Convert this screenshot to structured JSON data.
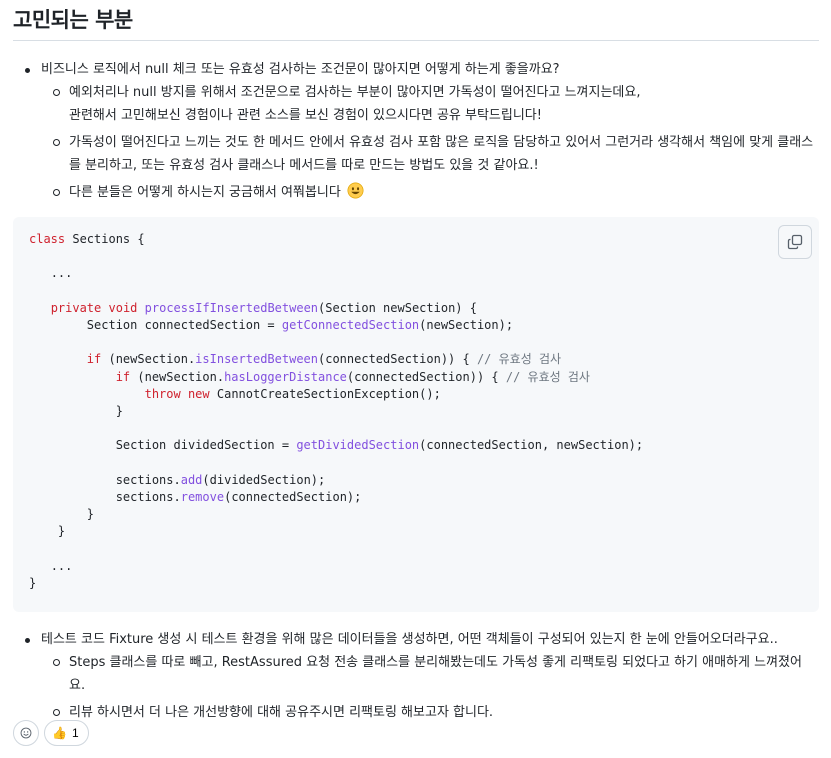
{
  "section_title": "고민되는 부분",
  "list_a": {
    "item": "비즈니스 로직에서 null 체크 또는 유효성 검사하는 조건문이 많아지면 어떻게 하는게 좋을까요?",
    "sub": [
      "예외처리나 null 방지를 위해서 조건문으로 검사하는 부분이 많아지면 가독성이 떨어진다고 느껴지는데요,",
      "관련해서 고민해보신 경험이나 관련 소스를 보신 경험이 있으시다면 공유 부탁드립니다!",
      "가독성이 떨어진다고 느끼는 것도 한 메서드 안에서 유효성 검사 포함 많은 로직을 담당하고 있어서 그런거라 생각해서 책임에 맞게 클래스",
      "를 분리하고, 또는 유효성 검사 클래스나 메서드를 따로 만드는 방법도 있을 것 같아요.!",
      "다른 분들은 어떻게 하시는지 궁금해서 여쭤봅니다"
    ]
  },
  "code": {
    "class_kw": "class",
    "class_name": " Sections {",
    "ellipsis": "...",
    "private_kw": "private",
    "void_kw": "void",
    "method1": "processIfInsertedBetween",
    "method1_args": "(Section newSection) {",
    "line_connected_a": "Section connectedSection = ",
    "method_getConnected": "getConnectedSection",
    "line_connected_b": "(newSection);",
    "if_kw": "if",
    "if1_a": " (newSection.",
    "method_isInserted": "isInsertedBetween",
    "if1_b": "(connectedSection)) { ",
    "comment": "// 유효성 검사",
    "method_hasLogger": "hasLoggerDistance",
    "throw_kw": "throw",
    "new_kw": "new",
    "throw_rest": " CannotCreateSectionException();",
    "close_brace": "}",
    "line_divided_a": "Section dividedSection = ",
    "method_getDivided": "getDividedSection",
    "line_divided_b": "(connectedSection, newSection);",
    "sections_dot": "sections.",
    "method_add": "add",
    "add_rest": "(dividedSection);",
    "method_remove": "remove",
    "remove_rest": "(connectedSection);"
  },
  "list_b": {
    "item": "테스트 코드 Fixture 생성 시 테스트 환경을 위해 많은 데이터들을 생성하면, 어떤 객체들이 구성되어 있는지 한 눈에 안들어오더라구요..",
    "sub": [
      "Steps 클래스를 따로 빼고, RestAssured 요청 전송 클래스를 분리해봤는데도 가독성 좋게 리팩토링 되었다고 하기 애매하게 느껴졌어",
      "요.",
      "리뷰 하시면서 더 나은 개선방향에 대해 공유주시면 리팩토링 해보고자 합니다."
    ]
  },
  "reactions": {
    "add_icon": "smiley-add-icon",
    "thumbs_emoji": "👍",
    "thumbs_count": "1"
  },
  "colors": {
    "keyword": "#cf222e",
    "function": "#8250df",
    "comment": "#6e7781",
    "code_bg": "#f6f8fa",
    "border": "#d0d7de"
  }
}
